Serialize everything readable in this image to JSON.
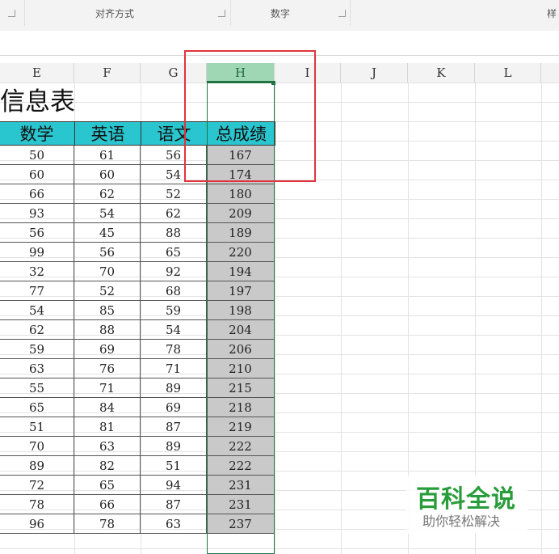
{
  "ribbon": {
    "groups": [
      {
        "label": "对齐方式"
      },
      {
        "label": "数字"
      },
      {
        "label": "样"
      }
    ]
  },
  "columns": [
    "E",
    "F",
    "G",
    "H",
    "I",
    "J",
    "K",
    "L"
  ],
  "selected_column": "H",
  "sheet": {
    "title": "信息表",
    "headers": [
      "数学",
      "英语",
      "语文",
      "总成绩"
    ],
    "rows": [
      [
        "50",
        "61",
        "56",
        "167"
      ],
      [
        "60",
        "60",
        "54",
        "174"
      ],
      [
        "66",
        "62",
        "52",
        "180"
      ],
      [
        "93",
        "54",
        "62",
        "209"
      ],
      [
        "56",
        "45",
        "88",
        "189"
      ],
      [
        "99",
        "56",
        "65",
        "220"
      ],
      [
        "32",
        "70",
        "92",
        "194"
      ],
      [
        "77",
        "52",
        "68",
        "197"
      ],
      [
        "54",
        "85",
        "59",
        "198"
      ],
      [
        "62",
        "88",
        "54",
        "204"
      ],
      [
        "59",
        "69",
        "78",
        "206"
      ],
      [
        "63",
        "76",
        "71",
        "210"
      ],
      [
        "55",
        "71",
        "89",
        "215"
      ],
      [
        "65",
        "84",
        "69",
        "218"
      ],
      [
        "51",
        "81",
        "87",
        "219"
      ],
      [
        "70",
        "63",
        "89",
        "222"
      ],
      [
        "89",
        "82",
        "51",
        "222"
      ],
      [
        "72",
        "65",
        "94",
        "231"
      ],
      [
        "78",
        "66",
        "87",
        "231"
      ],
      [
        "96",
        "78",
        "63",
        "237"
      ]
    ]
  },
  "watermark": {
    "logo": "百科全说",
    "subtitle": "助你轻松解决"
  },
  "colors": {
    "header_fill": "#2ac6cf",
    "total_fill": "#c9c9c9",
    "selection": "#217346",
    "highlight_box": "#e0343d"
  }
}
